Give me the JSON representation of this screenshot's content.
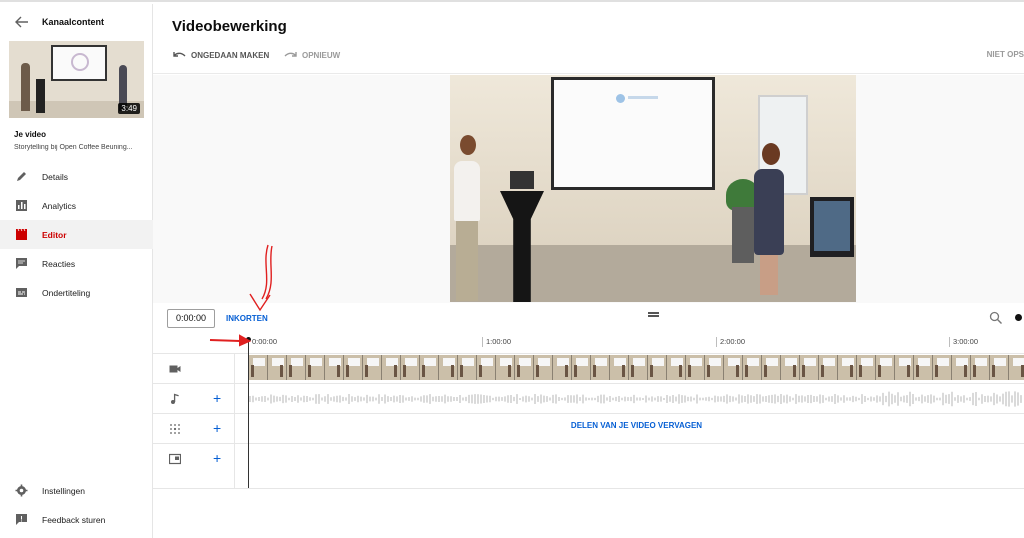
{
  "sidebar": {
    "header_title": "Kanaalcontent",
    "video_duration": "3:49",
    "your_video_label": "Je video",
    "video_title": "Storytelling bij Open Coffee Beuning...",
    "items": [
      {
        "label": "Details",
        "icon": "pencil-icon"
      },
      {
        "label": "Analytics",
        "icon": "analytics-icon"
      },
      {
        "label": "Editor",
        "icon": "editor-clapper-icon",
        "active": true
      },
      {
        "label": "Reacties",
        "icon": "comments-icon"
      },
      {
        "label": "Ondertiteling",
        "icon": "subtitles-icon"
      }
    ],
    "bottom_items": [
      {
        "label": "Instellingen",
        "icon": "gear-icon"
      },
      {
        "label": "Feedback sturen",
        "icon": "feedback-icon"
      }
    ],
    "active_color": "#cc0000"
  },
  "header": {
    "title": "Videobewerking",
    "undo_label": "ONGEDAAN MAKEN",
    "redo_label": "OPNIEUW",
    "not_published_label": "NIET OPS"
  },
  "timeline": {
    "current_time": "0:00:00",
    "trim_label": "INKORTEN",
    "ruler_ticks": [
      "0:00:00",
      "1:00:00",
      "2:00:00",
      "3:00:00"
    ],
    "replace_label": "DELEN VAN JE VIDEO VERVAGEN",
    "tracks": [
      {
        "name": "video-track",
        "icon": "video-camera-icon",
        "plus": false
      },
      {
        "name": "audio-track",
        "icon": "music-note-icon",
        "plus": true
      },
      {
        "name": "blur-track",
        "icon": "blur-icon",
        "plus": true
      },
      {
        "name": "endscreen-track",
        "icon": "end-screen-icon",
        "plus": true
      }
    ],
    "accent_color": "#065fd4"
  },
  "annotations": {
    "color": "#e02020",
    "items": [
      "red-arrow-to-trim",
      "red-arrow-to-playhead"
    ]
  }
}
